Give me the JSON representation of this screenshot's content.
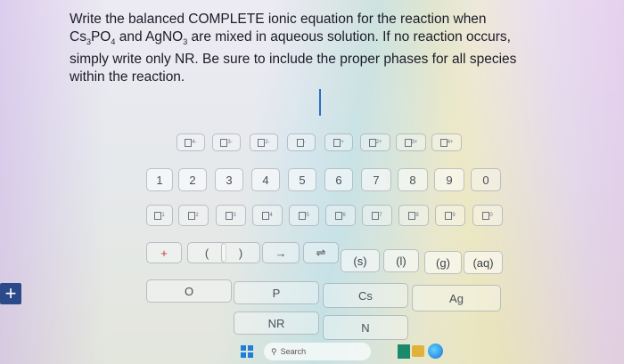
{
  "question": {
    "line1": "Write the balanced COMPLETE ionic equation for the reaction when",
    "cs": "Cs",
    "cs_sub": "3",
    "po": "PO",
    "po_sub": "4",
    "and": " and AgNO",
    "no_sub": "3",
    "line2_rest": " are mixed in aqueous solution. If no reaction occurs,",
    "line3": "simply write only NR. Be sure to include the proper phases for all species",
    "line4": "within the reaction."
  },
  "charge_keys": [
    "4-",
    "3-",
    "2-",
    "-",
    "+",
    "2+",
    "3+",
    "4+"
  ],
  "digit_keys": [
    "1",
    "2",
    "3",
    "4",
    "5",
    "6",
    "7",
    "8",
    "9",
    "0"
  ],
  "subscript_keys": [
    "1",
    "2",
    "3",
    "4",
    "5",
    "6",
    "7",
    "8",
    "9",
    "0"
  ],
  "symbol_keys": {
    "plus": "+",
    "open_paren": "(",
    "close_paren": ")",
    "arrow": "→",
    "equilibrium": "⇌",
    "solid": "(s)",
    "liquid": "(l)",
    "gas": "(g)",
    "aqueous": "(aq)"
  },
  "element_keys": {
    "o": "O",
    "p": "P",
    "cs": "Cs",
    "ag": "Ag",
    "nr": "NR",
    "n": "N"
  },
  "side_button": "+",
  "taskbar": {
    "search_label": "Search"
  }
}
